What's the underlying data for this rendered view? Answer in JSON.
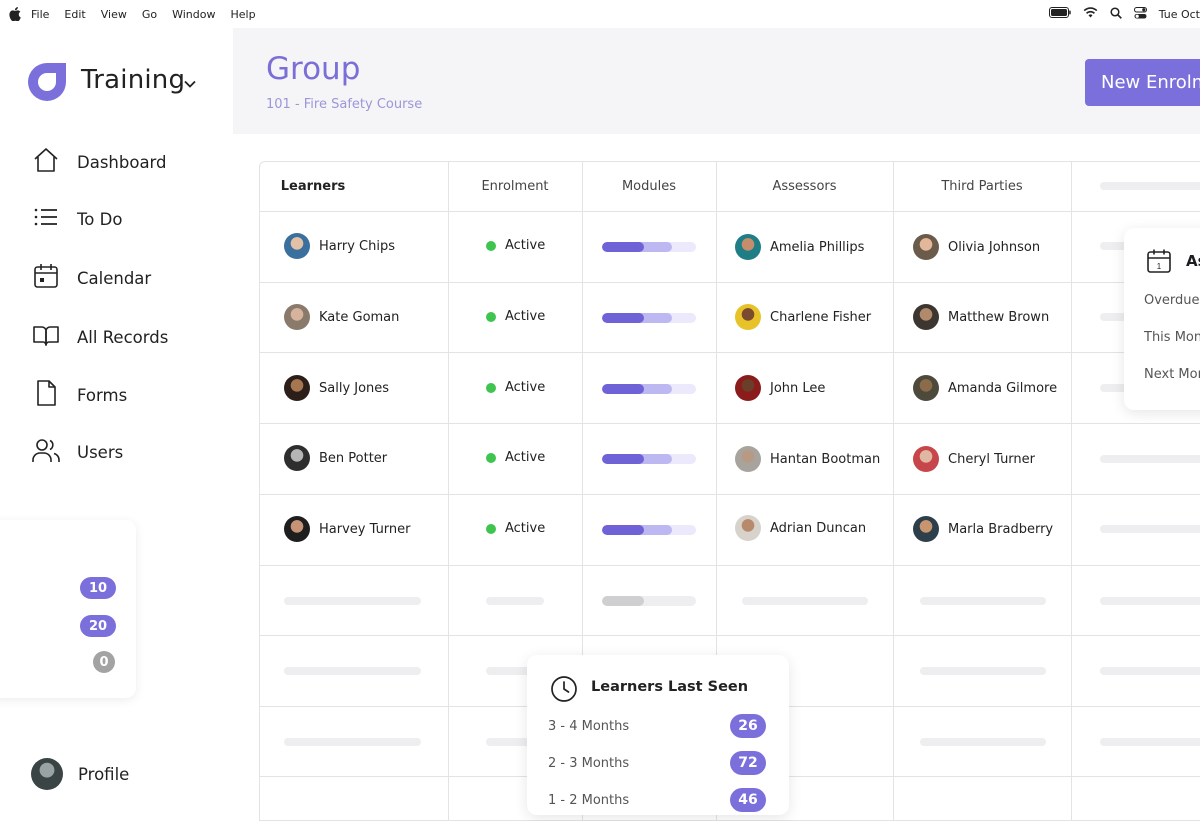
{
  "menubar": {
    "items": [
      "File",
      "Edit",
      "View",
      "Go",
      "Window",
      "Help"
    ],
    "clock": "Tue Oct"
  },
  "sidebar": {
    "brand": "Training",
    "nav": [
      {
        "label": "Dashboard",
        "icon": "home-icon"
      },
      {
        "label": "To Do",
        "icon": "list-icon"
      },
      {
        "label": "Calendar",
        "icon": "calendar-icon"
      },
      {
        "label": "All Records",
        "icon": "book-icon"
      },
      {
        "label": "Forms",
        "icon": "file-icon"
      },
      {
        "label": "Users",
        "icon": "users-icon"
      }
    ],
    "counts": [
      "10",
      "20",
      "0"
    ],
    "profile_label": "Profile"
  },
  "header": {
    "title": "Group",
    "subtitle": "101 - Fire Safety Course",
    "new_button": "New Enrolm"
  },
  "table": {
    "columns": [
      "Learners",
      "Enrolment",
      "Modules",
      "Assessors",
      "Third Parties"
    ],
    "rows": [
      {
        "learner": "Harry Chips",
        "status": "Active",
        "progress": 0.45,
        "progress2": 0.75,
        "assessor": "Amelia Phillips",
        "third_party": "Olivia Johnson"
      },
      {
        "learner": "Kate Goman",
        "status": "Active",
        "progress": 0.45,
        "progress2": 0.75,
        "assessor": "Charlene Fisher",
        "third_party": "Matthew Brown"
      },
      {
        "learner": "Sally Jones",
        "status": "Active",
        "progress": 0.45,
        "progress2": 0.75,
        "assessor": "John Lee",
        "third_party": "Amanda Gilmore"
      },
      {
        "learner": "Ben Potter",
        "status": "Active",
        "progress": 0.45,
        "progress2": 0.75,
        "assessor": "Hantan Bootman",
        "third_party": "Cheryl Turner"
      },
      {
        "learner": "Harvey Turner",
        "status": "Active",
        "progress": 0.45,
        "progress2": 0.75,
        "assessor": "Adrian Duncan",
        "third_party": "Marla Bradberry"
      }
    ]
  },
  "assessments_card": {
    "title": "As",
    "items": [
      "Overdue",
      "This Mon",
      "Next Mor"
    ]
  },
  "last_seen": {
    "title": "Learners Last Seen",
    "rows": [
      {
        "label": "3 - 4 Months",
        "count": "26"
      },
      {
        "label": "2 - 3 Months",
        "count": "72"
      },
      {
        "label": "1 - 2 Months",
        "count": "46"
      }
    ]
  },
  "colors": {
    "accent": "#7b6fdc",
    "active_green": "#3ec44f",
    "count_grey": "#a3a3a3"
  }
}
